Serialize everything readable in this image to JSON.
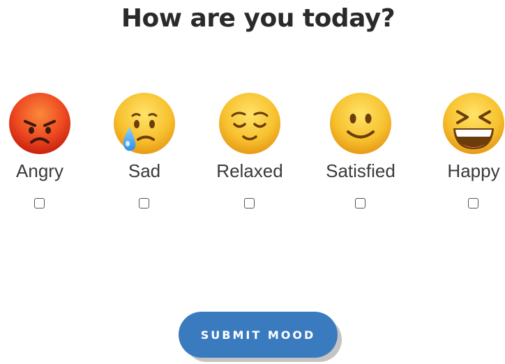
{
  "title": "How are you today?",
  "moods": [
    {
      "label": "Angry",
      "icon": "angry-face-icon",
      "checked": false
    },
    {
      "label": "Sad",
      "icon": "crying-face-icon",
      "checked": false
    },
    {
      "label": "Relaxed",
      "icon": "relieved-face-icon",
      "checked": false
    },
    {
      "label": "Satisfied",
      "icon": "slightly-smiling-face-icon",
      "checked": false
    },
    {
      "label": "Happy",
      "icon": "grinning-squinting-face-icon",
      "checked": false
    }
  ],
  "submit_label": "SUBMIT MOOD",
  "colors": {
    "button": "#3a7bbf",
    "title": "#2a2a2a",
    "label": "#3a3a3a",
    "emoji_yellow": "#f7c12e",
    "emoji_red": "#e8431e"
  }
}
